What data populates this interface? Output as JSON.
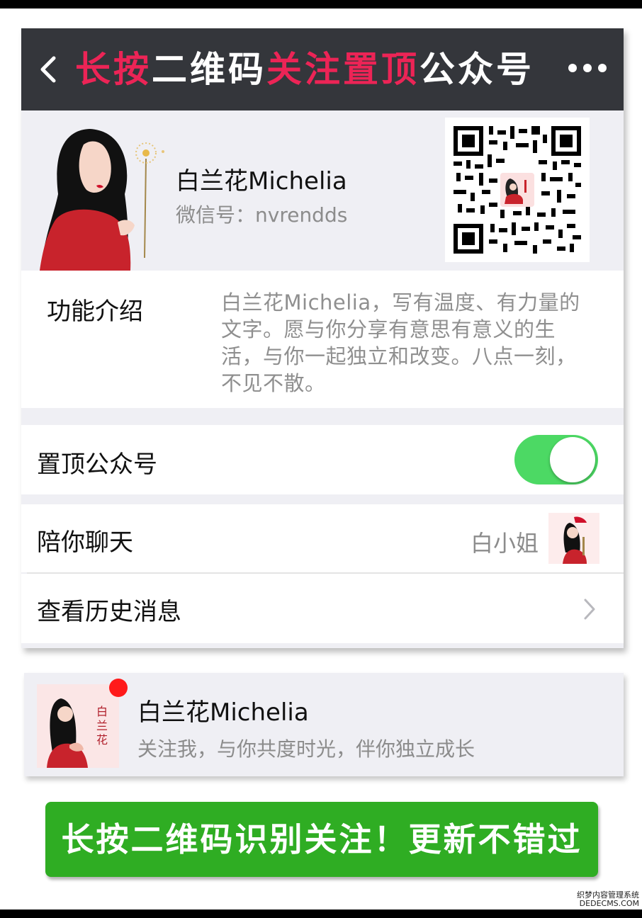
{
  "header": {
    "title_parts": [
      {
        "text": "长按",
        "color": "#ec2456"
      },
      {
        "text": "二维码",
        "color": "#ffffff"
      },
      {
        "text": "关注置顶",
        "color": "#ec2456"
      },
      {
        "text": "公众号",
        "color": "#ffffff"
      }
    ],
    "back_icon": "chevron-left-icon",
    "more_icon": "more-dots-icon"
  },
  "profile": {
    "name": "白兰花Michelia",
    "wechat_id": "微信号：nvrendds",
    "qr_icon": "qr-code"
  },
  "intro": {
    "label": "功能介绍",
    "text": "白兰花Michelia，写有温度、有力量的文字。愿与你分享有意思有意义的生活，与你一起独立和改变。八点一刻，不见不散。"
  },
  "settings": {
    "pin_label": "置顶公众号",
    "pin_on": true,
    "chat_label": "陪你聊天",
    "chat_value": "白小姐",
    "history_label": "查看历史消息"
  },
  "account_card": {
    "name": "白兰花Michelia",
    "slogan": "关注我，与你共度时光，伴你独立成长",
    "logo_text": "白兰花"
  },
  "cta": {
    "label": "长按二维码识别关注！更新不错过"
  },
  "watermark": {
    "line1": "织梦内容管理系统",
    "line2": "DEDECMS.COM"
  },
  "colors": {
    "accent_red": "#ec2456",
    "nav_bg": "#34363b",
    "toggle_green": "#4cd964",
    "cta_green": "#2fad23"
  }
}
